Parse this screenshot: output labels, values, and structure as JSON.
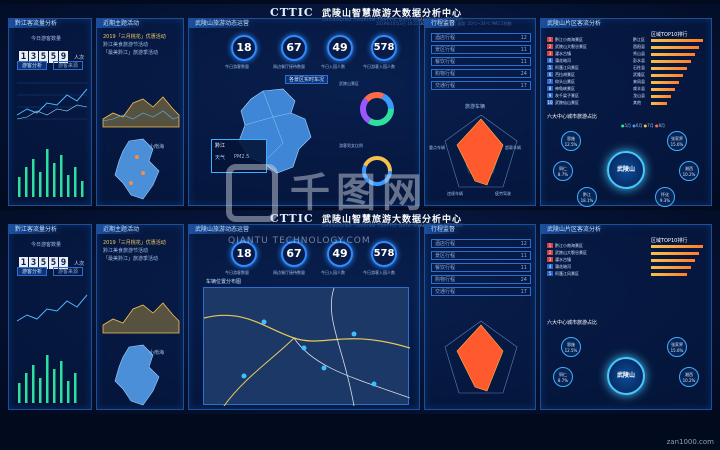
{
  "header": {
    "logo": "CTTIC",
    "title": "武陵山智慧旅游大数据分析中心",
    "subtitle": "CHONGQING TOURISM TRAFFIC DATA ANALYSIS PLATFORM",
    "time_readout": "2019年10月2日 10:25:30  PM2.5  小雨微风  温度: 20℃~24℃  PM2.5指数"
  },
  "left_panel": {
    "title": "黔江客流量分析",
    "today_label": "今日游客数量",
    "digits": [
      "1",
      "3",
      "5",
      "5",
      "9"
    ],
    "unit": "人次",
    "btn_active": "游客分析",
    "btn_inactive": "游客来源"
  },
  "mid_left_panel": {
    "title": "近期主题活动",
    "items": [
      "2019「三月桃花」优惠活动",
      "黔江美食旅游节活动",
      "「最美黔江」旅游季活动"
    ],
    "map_label": "小南海"
  },
  "center_panel": {
    "title": "武陵山旅游动态运营",
    "stats": [
      {
        "value": "18",
        "label": "今日游客数量"
      },
      {
        "value": "67",
        "label": "周边餐厅接待数量"
      },
      {
        "value": "49",
        "label": "今日入园人数"
      },
      {
        "value": "578",
        "label": "今日游客入园人数"
      }
    ],
    "map_title": "各景区实时车况",
    "map_tooltip": "黔江",
    "weather": "天气",
    "weather_val": "PM2.5",
    "donut_label": "武陵山景区",
    "donut_label2": "游客男女比例"
  },
  "bottom_center": {
    "map_title": "车辆位置分布图"
  },
  "right_mid_panel": {
    "title": "行程监督",
    "rows": [
      {
        "label": "酒店行程",
        "value": "12"
      },
      {
        "label": "景区行程",
        "value": "11"
      },
      {
        "label": "餐饮行程",
        "value": "11"
      },
      {
        "label": "购物行程",
        "value": "24"
      },
      {
        "label": "交通行程",
        "value": "17"
      }
    ],
    "radar_title": "旅游车辆",
    "radar_labels": [
      "超速车辆",
      "超载车辆",
      "疲劳驾驶",
      "重点车辆",
      "违规车辆"
    ]
  },
  "right_panel": {
    "title": "武陵山片区客流分析",
    "top_title": "区域TOP10排行",
    "top_left": [
      {
        "rank": "1",
        "name": "黔江小南海景区"
      },
      {
        "rank": "2",
        "name": "武陵山大裂谷景区"
      },
      {
        "rank": "3",
        "name": "濯水古镇"
      },
      {
        "rank": "4",
        "name": "蒲花暗河"
      },
      {
        "rank": "5",
        "name": "阿蓬江风景区"
      },
      {
        "rank": "6",
        "name": "芭拉胡景区"
      },
      {
        "rank": "7",
        "name": "仰头山景区"
      },
      {
        "rank": "8",
        "name": "神龟峡景区"
      },
      {
        "rank": "9",
        "name": "灰千梁子景区"
      },
      {
        "rank": "10",
        "name": "武陵仙山景区"
      }
    ],
    "top_right": [
      {
        "name": "黔江区",
        "value": "1"
      },
      {
        "name": "酉阳县",
        "value": "2"
      },
      {
        "name": "秀山县",
        "value": "3"
      },
      {
        "name": "彭水县",
        "value": "4"
      },
      {
        "name": "石柱县",
        "value": "5"
      },
      {
        "name": "武隆区",
        "value": "6"
      },
      {
        "name": "来凤县",
        "value": "7"
      },
      {
        "name": "咸丰县",
        "value": "8"
      },
      {
        "name": "龙山县",
        "value": "9"
      },
      {
        "name": "其他",
        "value": "10"
      }
    ],
    "ring_title": "六大中心城市旅游占比",
    "legend": [
      "5月",
      "6月",
      "7月",
      "8月"
    ],
    "center_label": "武陵山",
    "bubbles": [
      {
        "name": "恩施",
        "pct": "12.5%"
      },
      {
        "name": "张家界",
        "pct": "15.6%"
      },
      {
        "name": "铜仁",
        "pct": "8.7%"
      },
      {
        "name": "湘西",
        "pct": "10.2%"
      },
      {
        "name": "黔江",
        "pct": "18.1%"
      },
      {
        "name": "怀化",
        "pct": "9.3%"
      }
    ]
  },
  "watermark": {
    "cn": "千图网",
    "en": "QIANTU TECHNOLOGY.COM"
  },
  "footer": {
    "site": "zan1000.com"
  },
  "colors": {
    "accent": "#2f8bff",
    "background": "#020a1e",
    "highlight": "#f6c04d"
  }
}
